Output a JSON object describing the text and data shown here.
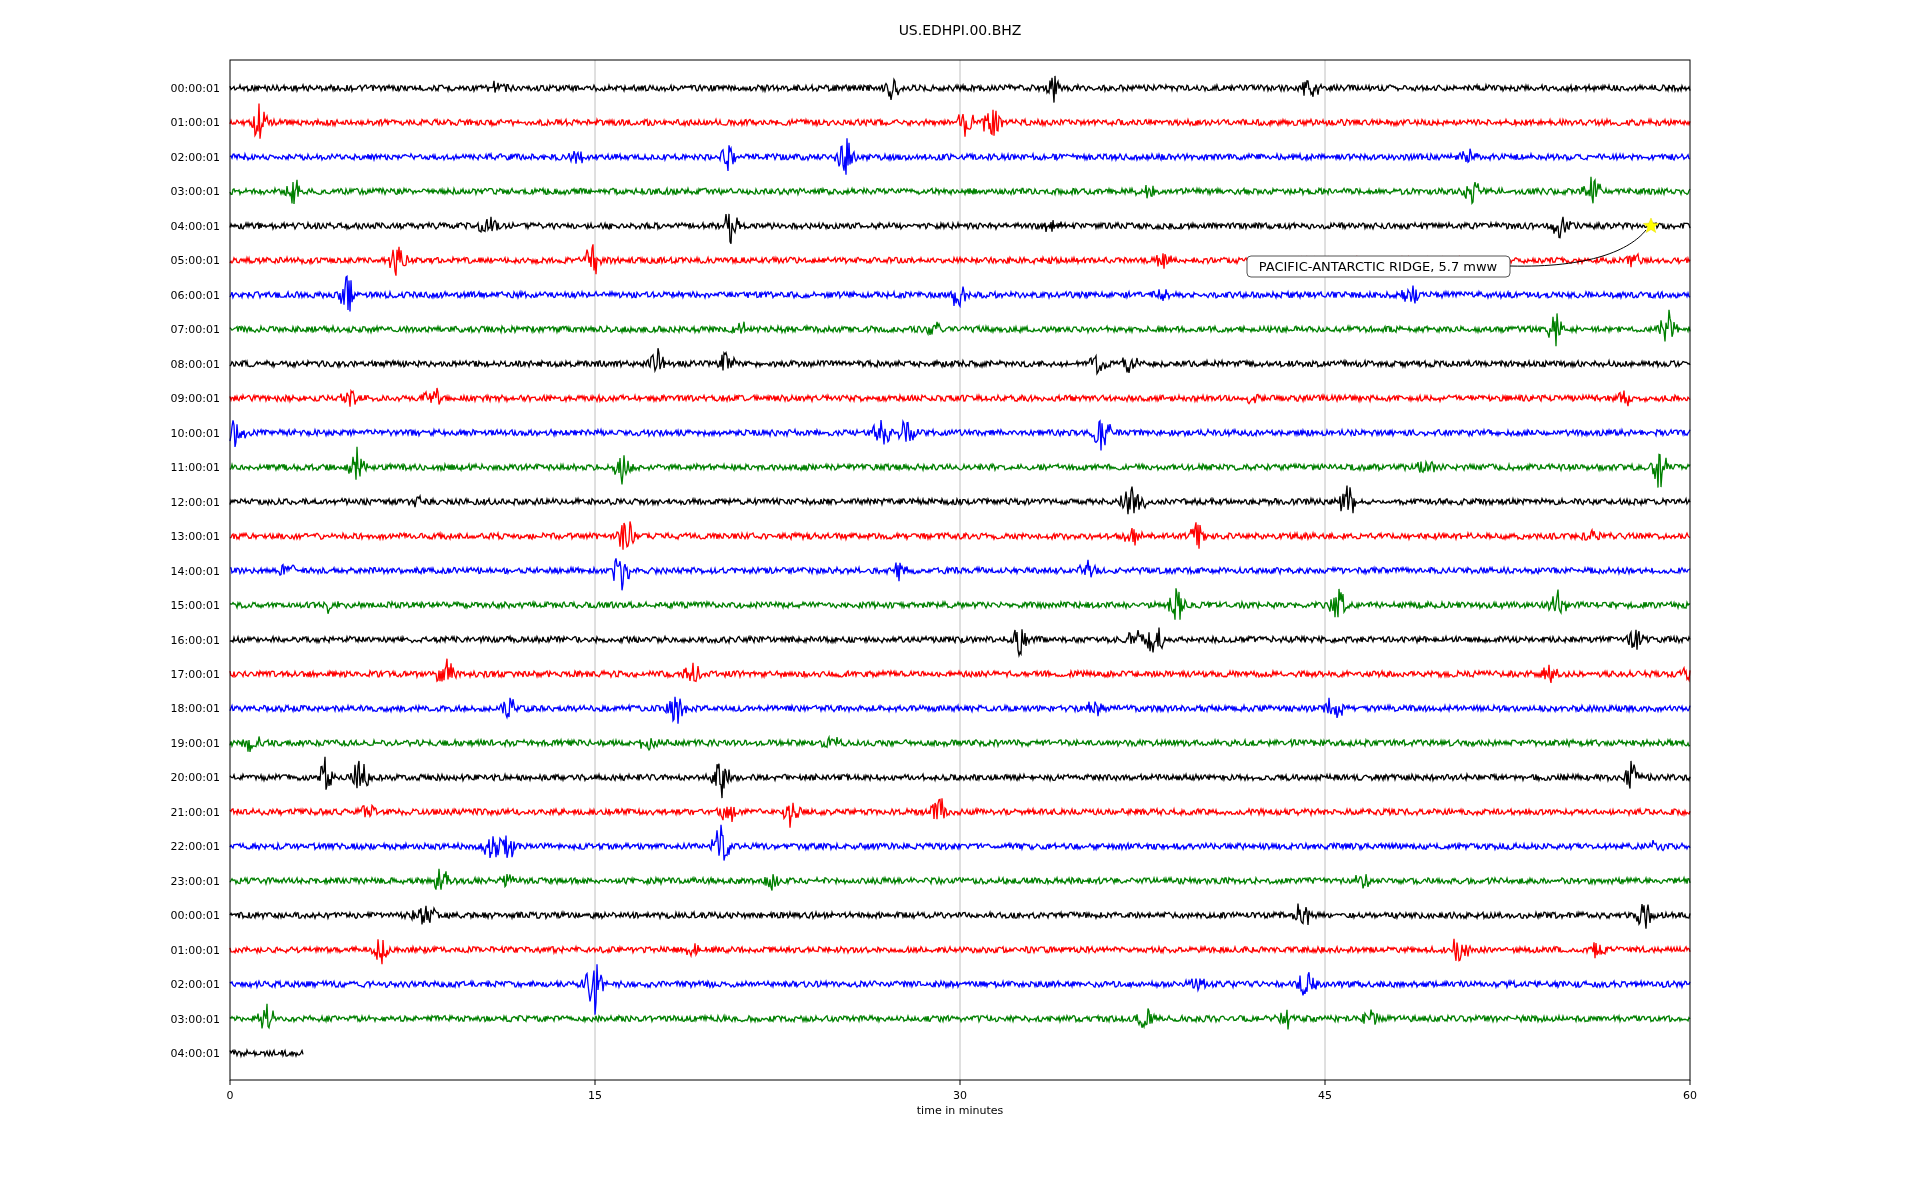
{
  "title": "US.EDHPI.00.BHZ",
  "rows": [
    {
      "label": "00:00:01",
      "color": "#000000",
      "level": 1
    },
    {
      "label": "01:00:01",
      "color": "#ff0000",
      "level": 1
    },
    {
      "label": "02:00:01",
      "color": "#0000ff",
      "level": 1
    },
    {
      "label": "03:00:01",
      "color": "#008000",
      "level": 1
    },
    {
      "label": "04:00:01",
      "color": "#000000",
      "level": 1
    },
    {
      "label": "05:00:01",
      "color": "#ff0000",
      "level": 1
    },
    {
      "label": "06:00:01",
      "color": "#0000ff",
      "level": 1
    },
    {
      "label": "07:00:01",
      "color": "#008000",
      "level": 1
    },
    {
      "label": "08:00:01",
      "color": "#000000",
      "level": 1
    },
    {
      "label": "09:00:01",
      "color": "#ff0000",
      "level": 1
    },
    {
      "label": "10:00:01",
      "color": "#0000ff",
      "level": 1
    },
    {
      "label": "11:00:01",
      "color": "#008000",
      "level": 1
    },
    {
      "label": "12:00:01",
      "color": "#000000",
      "level": 1
    },
    {
      "label": "13:00:01",
      "color": "#ff0000",
      "level": 1
    },
    {
      "label": "14:00:01",
      "color": "#0000ff",
      "level": 1
    },
    {
      "label": "15:00:01",
      "color": "#008000",
      "level": 1
    },
    {
      "label": "16:00:01",
      "color": "#000000",
      "level": 1
    },
    {
      "label": "17:00:01",
      "color": "#ff0000",
      "level": 1
    },
    {
      "label": "18:00:01",
      "color": "#0000ff",
      "level": 1
    },
    {
      "label": "19:00:01",
      "color": "#008000",
      "level": 1
    },
    {
      "label": "20:00:01",
      "color": "#000000",
      "level": 1
    },
    {
      "label": "21:00:01",
      "color": "#ff0000",
      "level": 1
    },
    {
      "label": "22:00:01",
      "color": "#0000ff",
      "level": 1
    },
    {
      "label": "23:00:01",
      "color": "#008000",
      "level": 1
    },
    {
      "label": "00:00:01",
      "color": "#000000",
      "level": 1
    },
    {
      "label": "01:00:01",
      "color": "#ff0000",
      "level": 1
    },
    {
      "label": "02:00:01",
      "color": "#0000ff",
      "level": 1
    },
    {
      "label": "03:00:01",
      "color": "#008000",
      "level": 1
    },
    {
      "label": "04:00:01",
      "color": "#000000",
      "level": 0.05
    }
  ],
  "xticks": [
    "0",
    "15",
    "30",
    "45",
    "60"
  ],
  "xlabel": "time in minutes",
  "event": {
    "label": "PACIFIC-ANTARCTIC RIDGE, 5.7 mww"
  }
}
